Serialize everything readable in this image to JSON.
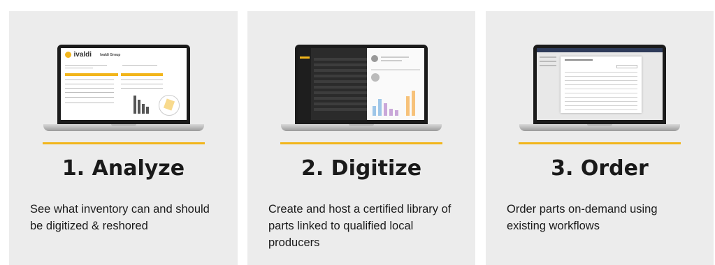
{
  "steps": [
    {
      "title": "1. Analyze",
      "description": "See what inventory can and should be digitized & reshored",
      "screen": {
        "logo_text": "ivaldi",
        "report_title": "Ivaldi Group"
      }
    },
    {
      "title": "2. Digitize",
      "description": "Create and host a certified library of parts linked to qualified local producers"
    },
    {
      "title": "3. Order",
      "description": "Order parts on-demand using existing workflows"
    }
  ],
  "colors": {
    "accent": "#f2b51b",
    "card": "#ececec",
    "text": "#1a1a1a"
  }
}
